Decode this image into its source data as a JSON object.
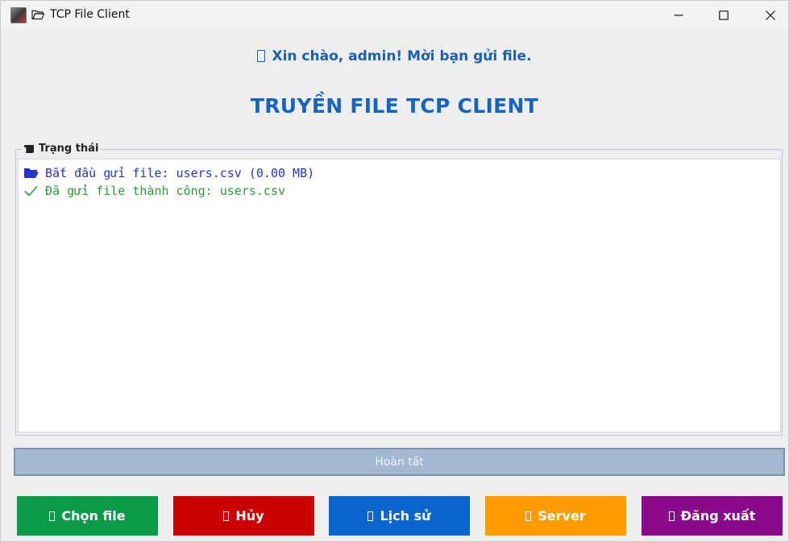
{
  "window": {
    "title": "TCP File Client",
    "app_icon": "java-app-icon",
    "title_icon": "folder-open-icon",
    "controls": [
      "minimize-icon",
      "maximize-icon",
      "close-icon"
    ]
  },
  "greeting": {
    "icon": "missing-glyph-icon",
    "text": "Xin chào, admin! Mời bạn gửi file."
  },
  "heading": "TRUYỀN FILE TCP CLIENT",
  "status_panel": {
    "legend_icon": "scroll-icon",
    "legend": "Trạng thái",
    "log": [
      {
        "icon": "folder-open-icon",
        "text": "Bắt đầu gửi file: users.csv (0.00 MB)",
        "color": "#2a35c8"
      },
      {
        "icon": "check-icon",
        "text": "Đã gửi file thành công: users.csv",
        "color": "#2e9a3a"
      }
    ]
  },
  "progress": {
    "label": "Hoàn tất",
    "color": "#a3b8d1"
  },
  "buttons": [
    {
      "label": "Chọn file",
      "icon": "missing-glyph-icon",
      "color": "#0b9a47"
    },
    {
      "label": "Hủy",
      "icon": "missing-glyph-icon",
      "color": "#cc0000"
    },
    {
      "label": "Lịch sử",
      "icon": "missing-glyph-icon",
      "color": "#0a66cc"
    },
    {
      "label": "Server",
      "icon": "missing-glyph-icon",
      "color": "#ff9c00"
    },
    {
      "label": "Đăng xuất",
      "icon": "missing-glyph-icon",
      "color": "#8a0a8c"
    }
  ]
}
